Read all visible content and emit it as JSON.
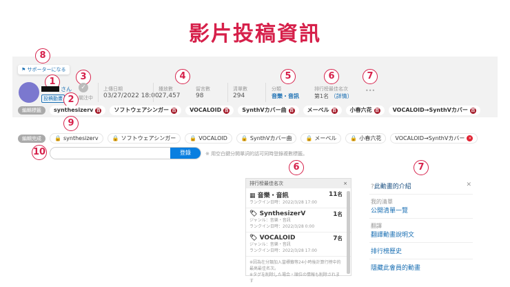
{
  "page_title": "影片投稿資訊",
  "annotations": [
    "1",
    "2",
    "3",
    "4",
    "5",
    "6",
    "7",
    "8",
    "9",
    "10",
    "6",
    "7"
  ],
  "supporter_label": "サポーターになる",
  "user": {
    "suffix": "さん",
    "videos_badge": "投稿動畫"
  },
  "follow": {
    "label": "關注中"
  },
  "stats": {
    "upload_label": "上傳日期",
    "upload_value": "03/27/2022 18:00",
    "views_label": "播放數",
    "views_value": "27,457",
    "comments_label": "留言數",
    "comments_value": "98",
    "mylist_label": "清單數",
    "mylist_value": "294",
    "category_label": "分類",
    "category_value": "音樂・音訊",
    "rank_label": "排行榜最佳名次",
    "rank_value": "第1名",
    "rank_detail": "（詳情）",
    "more": "•••"
  },
  "edit_label": "編輯標籤",
  "done_label": "編輯完成",
  "tags": [
    "synthesizerv",
    "ソフトウェアシンガー",
    "VOCALOID",
    "SynthVカバー曲",
    "メーベル",
    "小春六花",
    "VOCALOID→SynthVカバー"
  ],
  "tag_input": {
    "value": "",
    "button": "登錄",
    "hint": "※ 用空白鍵分開單詞的話可同時登錄複數標籤。"
  },
  "ranking_popup": {
    "title": "排行榜最佳名次",
    "items": [
      {
        "name": "音樂・音訊",
        "rank": "11",
        "unit": "名",
        "lines": [
          "ランクイン日時：2022/3/28 17:00"
        ]
      },
      {
        "name": "SynthesizerV",
        "rank": "1",
        "unit": "名",
        "lines": [
          "ジャンル：音樂・音訊",
          "ランクイン日時：2022/3/28 0:00"
        ]
      },
      {
        "name": "VOCALOID",
        "rank": "7",
        "unit": "名",
        "lines": [
          "ジャンル：音樂・音訊",
          "ランクイン日時：2022/3/28 17:00"
        ]
      }
    ],
    "notes": [
      "※因為在分類加入當標籤等24小時後計算行榜中的最高最佳名次。",
      "※タグを削除した場合・順位の情報も削除されます"
    ]
  },
  "menu": {
    "header": "此動畫的介紹",
    "items": [
      {
        "heading": "我的清單",
        "link": "公開清單一覽"
      },
      {
        "heading": "翻譯",
        "link": "翻譯動畫說明文"
      },
      {
        "heading": "",
        "link": "排行榜歷史"
      },
      {
        "heading": "",
        "link": "隱藏此會員的動畫"
      }
    ]
  }
}
